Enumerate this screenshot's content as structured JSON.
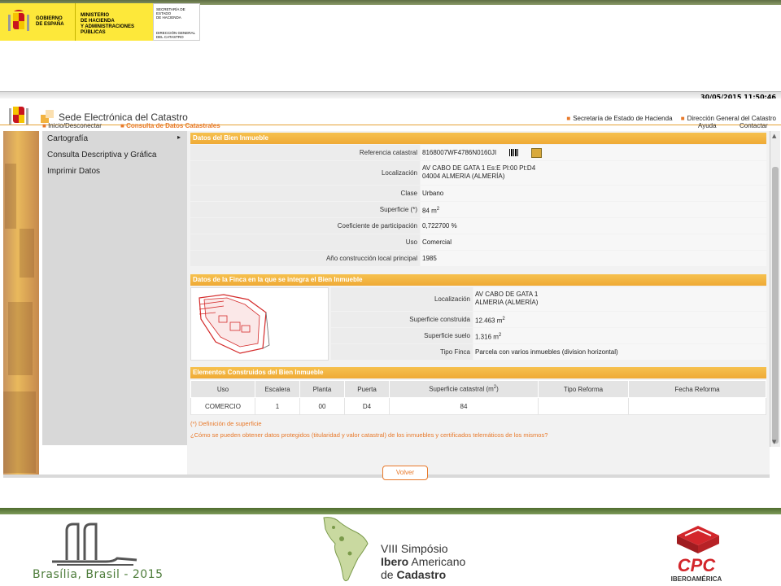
{
  "gov_logo": {
    "line1": "GOBIERNO",
    "line2": "DE ESPAÑA",
    "ministry1": "MINISTERIO",
    "ministry2": "DE HACIENDA",
    "ministry3": "Y ADMINISTRACIONES PÚBLICAS",
    "sec1": "SECRETARÍA DE ESTADO",
    "sec2": "DE HACIENDA",
    "dir1": "DIRECCIÓN GENERAL",
    "dir2": "DEL CATASTRO"
  },
  "header": {
    "timestamp": "30/05/2015 11:50:46",
    "site_title": "Sede Electrónica del Catastro",
    "link1": "Secretaría de Estado de Hacienda",
    "link2": "Dirección General del Catastro"
  },
  "nav": {
    "inicio": "Inicio/Desconectar",
    "consulta": "Consulta de Datos Catastrales",
    "ayuda": "Ayuda",
    "contactar": "Contactar"
  },
  "sidebar": {
    "items": [
      {
        "label": "Cartografía",
        "arrow": "▸"
      },
      {
        "label": "Consulta Descriptiva y Gráfica"
      },
      {
        "label": "Imprimir Datos"
      }
    ]
  },
  "bien": {
    "title": "Datos del Bien Inmueble",
    "ref_label": "Referencia catastral",
    "ref_value": "8168007WF4786N0160JI",
    "loc_label": "Localización",
    "loc_line1": "AV CABO DE GATA 1 Es:E Pl:00 Pt:D4",
    "loc_line2": "04004 ALMERIA (ALMERÍA)",
    "clase_label": "Clase",
    "clase_value": "Urbano",
    "sup_label": "Superficie (*)",
    "sup_value": "84 m",
    "coef_label": "Coeficiente de participación",
    "coef_value": "0,722700 %",
    "uso_label": "Uso",
    "uso_value": "Comercial",
    "anio_label": "Año construcción local principal",
    "anio_value": "1985"
  },
  "finca": {
    "title": "Datos de la Finca en la que se integra el Bien Inmueble",
    "loc_label": "Localización",
    "loc_line1": "AV CABO DE GATA 1",
    "loc_line2": "ALMERIA (ALMERÍA)",
    "sc_label": "Superficie construida",
    "sc_value": "12.463 m",
    "ss_label": "Superficie suelo",
    "ss_value": "1.316 m",
    "tf_label": "Tipo Finca",
    "tf_value": "Parcela con varios inmuebles (division horizontal)"
  },
  "elementos": {
    "title": "Elementos Construidos del Bien Inmueble",
    "columns": [
      "Uso",
      "Escalera",
      "Planta",
      "Puerta",
      "Superficie catastral (m",
      "Tipo Reforma",
      "Fecha Reforma"
    ],
    "rows": [
      [
        "COMERCIO",
        "1",
        "00",
        "D4",
        "84",
        "",
        ""
      ]
    ]
  },
  "notes": {
    "def": "(*) Definición de superficie",
    "question": "¿Cómo se pueden obtener datos protegidos (titularidad y valor catastral) de los inmuebles y certificados telemáticos de los mismos?"
  },
  "volver": "Volver",
  "footer": {
    "brasilia": "Brasília, Brasil - 2015",
    "simp1": "VIII Simpósio",
    "simp2a": "Ibero",
    "simp2b": " Americano",
    "simp3a": "de ",
    "simp3b": "Cadastro",
    "cpc": "CPC",
    "cpc_sub": "IBEROAMÉRICA"
  },
  "sup2": "2",
  "colors": {
    "accent": "#e8792a",
    "header_bar": "#f2b33f",
    "stripe": "#5f7a3d"
  }
}
